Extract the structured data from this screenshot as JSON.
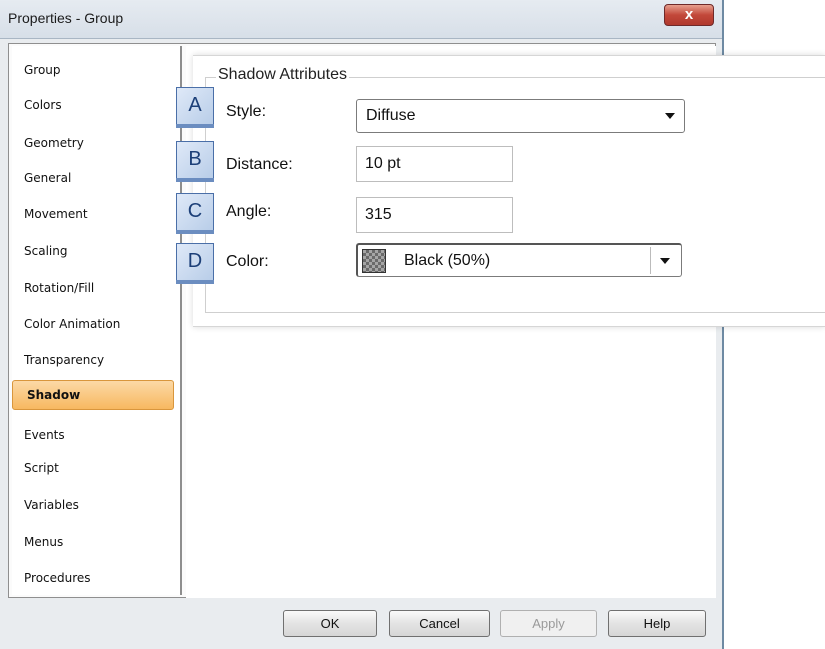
{
  "window": {
    "title": "Properties - Group",
    "close_symbol": "x"
  },
  "sidebar": {
    "items": [
      {
        "label": "Group"
      },
      {
        "label": "Colors"
      },
      {
        "label": "Geometry"
      },
      {
        "label": "General"
      },
      {
        "label": "Movement"
      },
      {
        "label": "Scaling"
      },
      {
        "label": "Rotation/Fill"
      },
      {
        "label": "Color Animation"
      },
      {
        "label": "Transparency"
      },
      {
        "label": "Shadow",
        "selected": true
      },
      {
        "label": "Events"
      },
      {
        "label": "Script"
      },
      {
        "label": "Variables"
      },
      {
        "label": "Menus"
      },
      {
        "label": "Procedures"
      }
    ]
  },
  "shadow": {
    "group_title": "Shadow Attributes",
    "style": {
      "badge": "A",
      "label": "Style:",
      "value": "Diffuse"
    },
    "distance": {
      "badge": "B",
      "label": "Distance:",
      "value": "10 pt"
    },
    "angle": {
      "badge": "C",
      "label": "Angle:",
      "value": "315"
    },
    "color": {
      "badge": "D",
      "label": "Color:",
      "value": "Black (50%)",
      "swatch_color": "#808080"
    }
  },
  "buttons": {
    "ok": "OK",
    "cancel": "Cancel",
    "apply": "Apply",
    "help": "Help"
  },
  "colors": {
    "selected_item": "#f7b860",
    "badge": "#b8cde8"
  }
}
